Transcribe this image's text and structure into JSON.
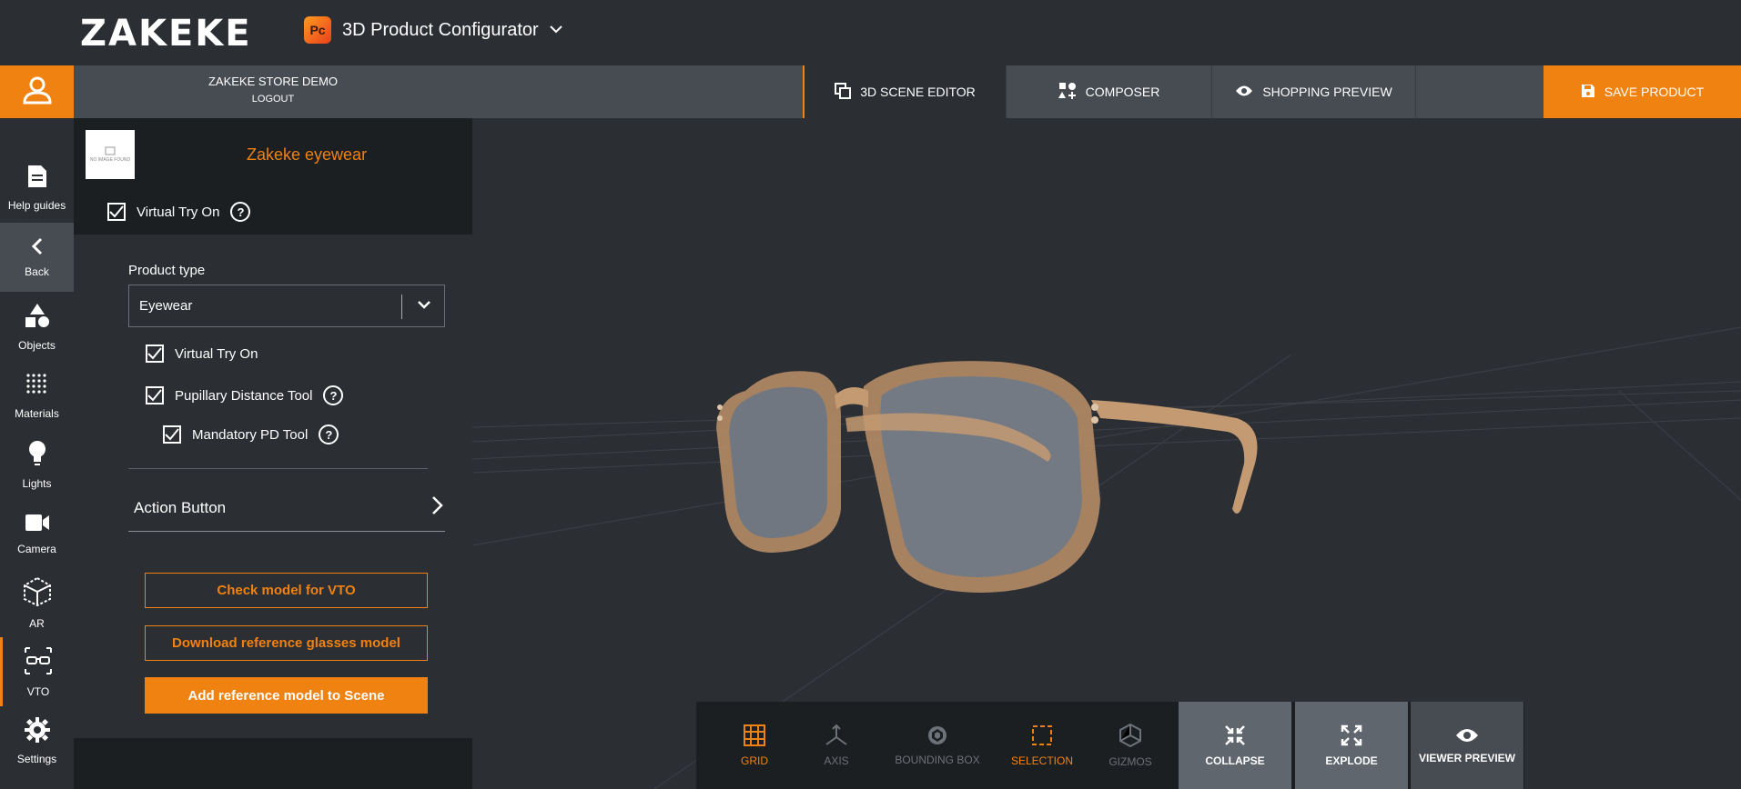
{
  "brand": {
    "logo_text": "ZAKEKE"
  },
  "app_switcher": {
    "icon_text": "Pc",
    "title": "3D Product Configurator"
  },
  "session": {
    "store_name": "ZAKEKE STORE DEMO",
    "logout_label": "LOGOUT"
  },
  "tabs": [
    {
      "label": "3D SCENE EDITOR",
      "icon": "scene-editor-icon",
      "active": true
    },
    {
      "label": "COMPOSER",
      "icon": "composer-icon",
      "active": false
    },
    {
      "label": "SHOPPING PREVIEW",
      "icon": "eye-icon",
      "active": false
    }
  ],
  "save_button": {
    "label": "SAVE PRODUCT",
    "icon": "floppy-disk-icon"
  },
  "sidebar": {
    "items": [
      {
        "label": "Help guides",
        "icon": "document-icon"
      },
      {
        "label": "Back",
        "icon": "chevron-left-icon"
      },
      {
        "label": "Objects",
        "icon": "shapes-icon"
      },
      {
        "label": "Materials",
        "icon": "dots-grid-icon"
      },
      {
        "label": "Lights",
        "icon": "bulb-icon"
      },
      {
        "label": "Camera",
        "icon": "camera-icon"
      },
      {
        "label": "AR",
        "icon": "cube-icon"
      },
      {
        "label": "VTO",
        "icon": "glasses-icon"
      },
      {
        "label": "Settings",
        "icon": "gear-icon"
      }
    ]
  },
  "panel": {
    "thumb_text": "NO IMAGE FOUND",
    "product_name": "Zakeke eyewear",
    "vto_toggle_label": "Virtual Try On",
    "product_type_label": "Product type",
    "product_type_value": "Eyewear",
    "options": [
      {
        "label": "Virtual Try On",
        "checked": true
      },
      {
        "label": "Pupillary Distance Tool",
        "checked": true
      },
      {
        "label": "Mandatory PD Tool",
        "checked": true
      }
    ],
    "action_button_label": "Action Button",
    "buttons": {
      "check_model": "Check model for VTO",
      "download_reference": "Download reference glasses model",
      "add_reference": "Add reference model to Scene"
    }
  },
  "toolbar": {
    "tools": [
      {
        "label": "GRID",
        "state": "active"
      },
      {
        "label": "AXIS",
        "state": "inactive"
      },
      {
        "label": "BOUNDING BOX",
        "state": "inactive"
      },
      {
        "label": "SELECTION",
        "state": "active"
      },
      {
        "label": "GIZMOS",
        "state": "inactive"
      },
      {
        "label": "COLLAPSE",
        "state": "button"
      },
      {
        "label": "EXPLODE",
        "state": "button"
      },
      {
        "label": "VIEWER PREVIEW",
        "state": "button"
      }
    ]
  },
  "colors": {
    "accent": "#f08212",
    "bg": "#2b2e33",
    "panel_dark": "#1c1f22",
    "bar": "#474b52"
  }
}
